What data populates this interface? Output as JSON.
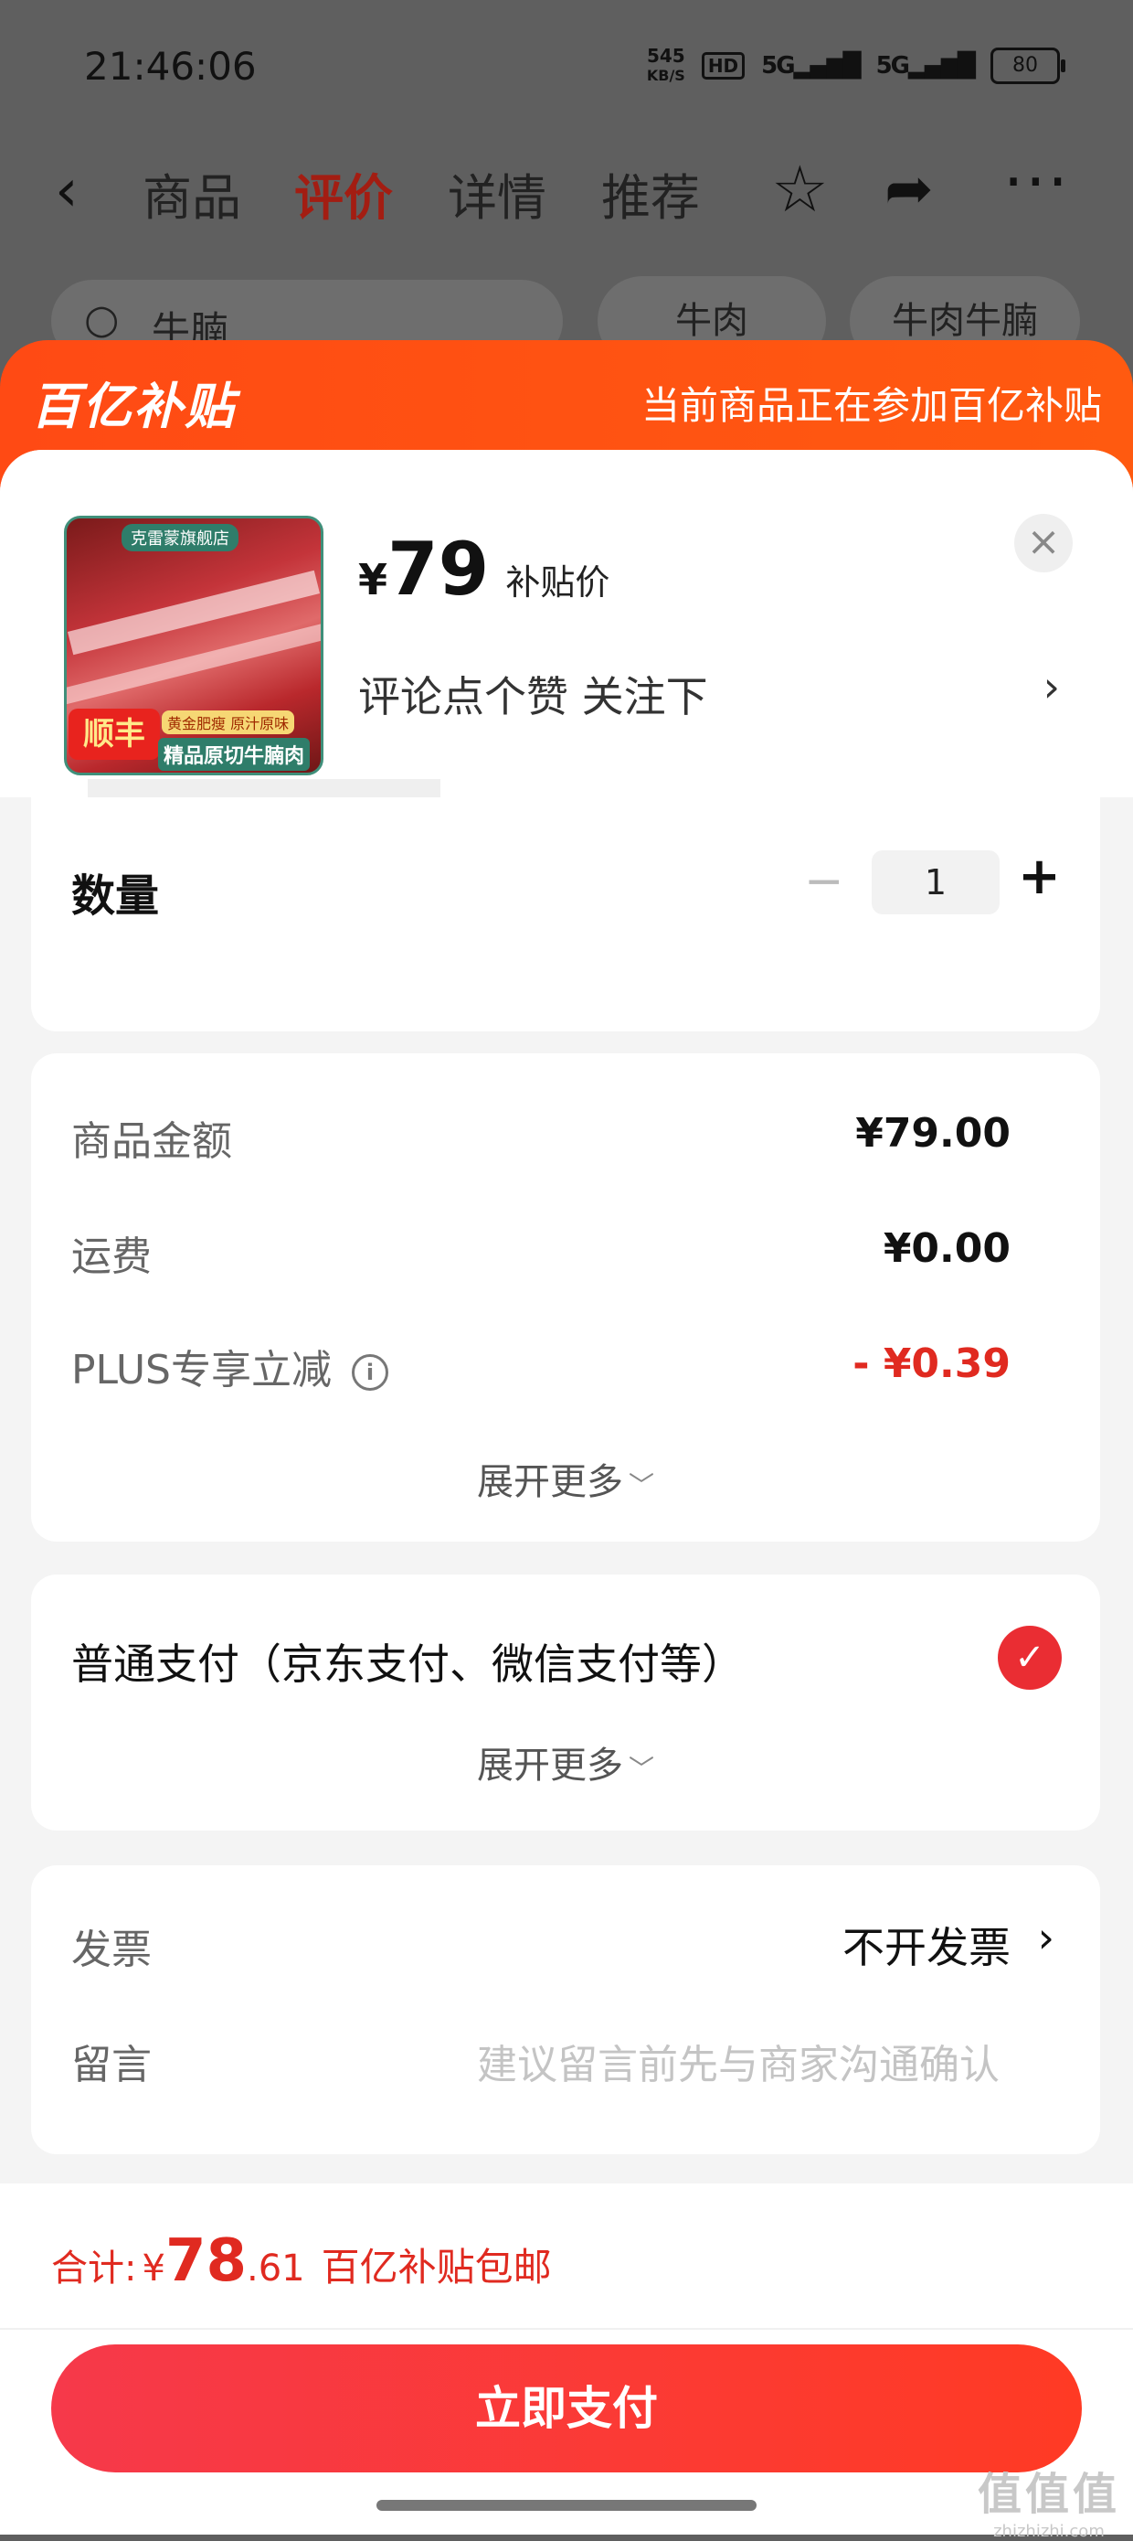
{
  "status_bar": {
    "time": "21:46:06",
    "net_speed_value": "545",
    "net_speed_unit": "KB/S",
    "hd": "HD",
    "signal1": "5G",
    "signal2": "5G",
    "battery": "80"
  },
  "nav": {
    "tabs": [
      "商品",
      "评价",
      "详情",
      "推荐"
    ],
    "active_tab": "评价"
  },
  "background_search": {
    "text": "牛腩",
    "chips": [
      "牛肉",
      "牛肉牛腩"
    ]
  },
  "banner": {
    "logo": "百亿补贴",
    "text": "当前商品正在参加百亿补贴"
  },
  "product": {
    "thumb_store": "克雷蒙旗舰店",
    "thumb_badge": "顺丰",
    "thumb_tag1": "黄金肥瘦 原汁原味",
    "thumb_tag2": "精品原切牛腩肉",
    "currency": "¥",
    "price": "79",
    "price_tag": "补贴价",
    "subtitle": "评论点个赞  关注下",
    "close_symbol": "×"
  },
  "quantity": {
    "label": "数量",
    "value": "1"
  },
  "price_detail": {
    "rows": [
      {
        "label": "商品金额",
        "value": "¥79.00"
      },
      {
        "label": "运费",
        "value": "¥0.00"
      },
      {
        "label": "PLUS专享立减",
        "value": "- ¥0.39"
      }
    ],
    "expand_label": "展开更多"
  },
  "payment": {
    "method": "普通支付（京东支付、微信支付等）",
    "expand_label": "展开更多"
  },
  "invoice": {
    "label": "发票",
    "value": "不开发票",
    "note_label": "留言",
    "note_placeholder": "建议留言前先与商家沟通确认"
  },
  "footer": {
    "total_label": "合计:",
    "currency": "¥",
    "total_int": "78",
    "total_dec": ".61",
    "free_shipping": "百亿补贴包邮",
    "pay_button": "立即支付"
  },
  "watermark": {
    "main": "值值值",
    "sub": "zhizhizhi.com"
  },
  "colors": {
    "accent_red": "#e02a20",
    "banner_orange": "#ff4a14",
    "pay_button": "#f6394a"
  }
}
